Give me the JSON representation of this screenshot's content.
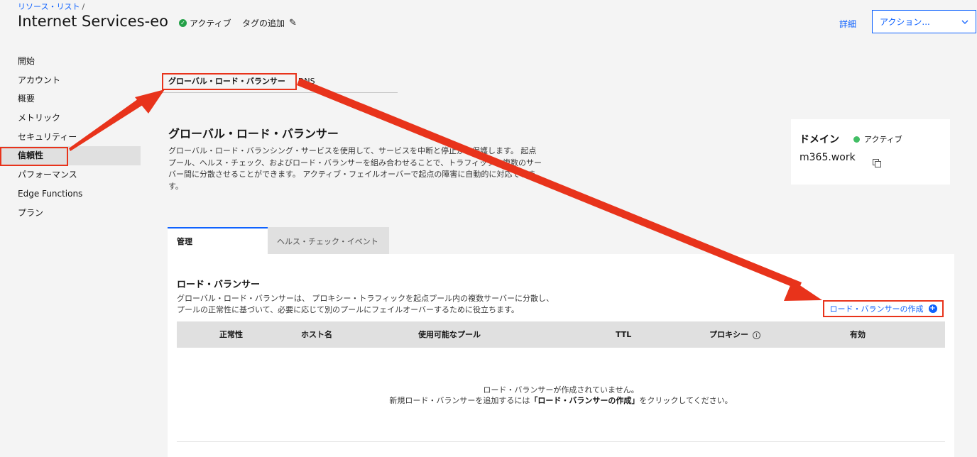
{
  "breadcrumb": {
    "link": "リソース・リスト",
    "separator": "/"
  },
  "header": {
    "title": "Internet Services-eo",
    "status": "アクティブ",
    "add_tag": "タグの追加",
    "details": "詳細",
    "actions": "アクション..."
  },
  "sidebar": {
    "items": [
      {
        "label": "開始"
      },
      {
        "label": "アカウント"
      },
      {
        "label": "概要"
      },
      {
        "label": "メトリック"
      },
      {
        "label": "セキュリティー"
      },
      {
        "label": "信頼性"
      },
      {
        "label": "パフォーマンス"
      },
      {
        "label": "Edge Functions"
      },
      {
        "label": "プラン"
      }
    ],
    "active": "信頼性"
  },
  "top_tabs": [
    {
      "label": "グローバル・ロード・バランサー"
    },
    {
      "label": "DNS"
    }
  ],
  "section": {
    "title": "グローバル・ロード・バランサー",
    "description": "グローバル・ロード・バランシング・サービスを使用して、サービスを中断と停止から保護します。 起点プール、ヘルス・チェック、およびロード・バランサーを組み合わせることで、トラフィックを複数のサーバー間に分散させることができます。 アクティブ・フェイルオーバーで起点の障害に自動的に対応できます。"
  },
  "domain": {
    "label": "ドメイン",
    "status": "アクティブ",
    "name": "m365.work"
  },
  "sub_tabs": [
    {
      "label": "管理"
    },
    {
      "label": "ヘルス・チェック・イベント"
    }
  ],
  "panel": {
    "title": "ロード・バランサー",
    "desc_line1": "グローバル・ロード・バランサーは、 プロキシー・トラフィックを起点プール内の複数サーバーに分散し、",
    "desc_line2": "プールの正常性に基づいて、必要に応じて別のプールにフェイルオーバーするために役立ちます。",
    "create_label": "ロード・バランサーの作成",
    "columns": [
      "正常性",
      "ホスト名",
      "使用可能なプール",
      "TTL",
      "プロキシー",
      "有効"
    ],
    "empty_line1": "ロード・バランサーが作成されていません。",
    "empty_line2_prefix": "新規ロード・バランサーを追加するには",
    "empty_line2_bold": "「ロード・バランサーの作成」",
    "empty_line2_suffix": "をクリックしてください。"
  },
  "colors": {
    "accent": "#0f62fe",
    "status_green": "#24a148",
    "annotation_red": "#e8331b"
  }
}
